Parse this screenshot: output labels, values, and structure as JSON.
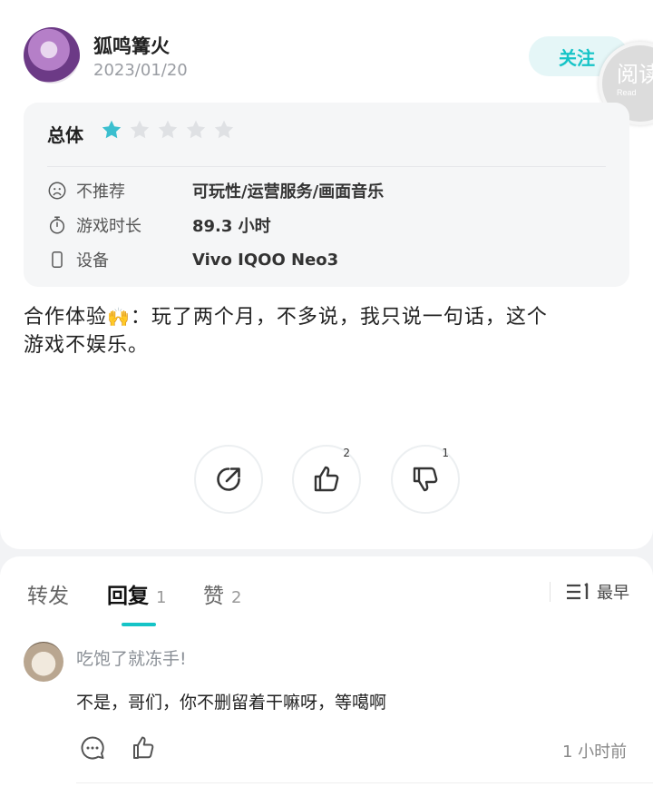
{
  "review": {
    "username": "狐鸣篝火",
    "date": "2023/01/20",
    "follow_label": "关注",
    "watermark": {
      "text": "阅读",
      "sub": "Read"
    },
    "rating": {
      "label": "总体",
      "stars": 1,
      "max_stars": 5,
      "star_color": "#3bbfcf"
    },
    "details": [
      {
        "icon": "sad-face-icon",
        "label": "不推荐",
        "value": "可玩性/运营服务/画面音乐"
      },
      {
        "icon": "stopwatch-icon",
        "label": "游戏时长",
        "value": "89.3 小时"
      },
      {
        "icon": "phone-icon",
        "label": "设备",
        "value": "Vivo IQOO Neo3"
      }
    ],
    "text_line1_a": "合作体验",
    "emoji": "🙌",
    "text_line1_b": "：玩了两个月，不多说，我只说一句话，这个",
    "text_line2": "游戏不娱乐。",
    "actions": {
      "share": {
        "icon": "share-icon"
      },
      "like": {
        "icon": "thumbs-up-icon",
        "count": "2"
      },
      "dislike": {
        "icon": "thumbs-down-icon",
        "count": "1"
      }
    }
  },
  "tabs": [
    {
      "label": "转发",
      "count": ""
    },
    {
      "label": "回复",
      "count": "1",
      "active": true
    },
    {
      "label": "赞",
      "count": "2"
    }
  ],
  "sort": {
    "icon": "sort-icon",
    "label": "最早"
  },
  "comments": [
    {
      "name": "吃饱了就冻手!",
      "text": "不是，哥们，你不删留着干嘛呀，等噶啊",
      "time": "1 小时前"
    }
  ],
  "colors": {
    "accent": "#15c4c7",
    "accent_bg": "#e5f6f7"
  }
}
